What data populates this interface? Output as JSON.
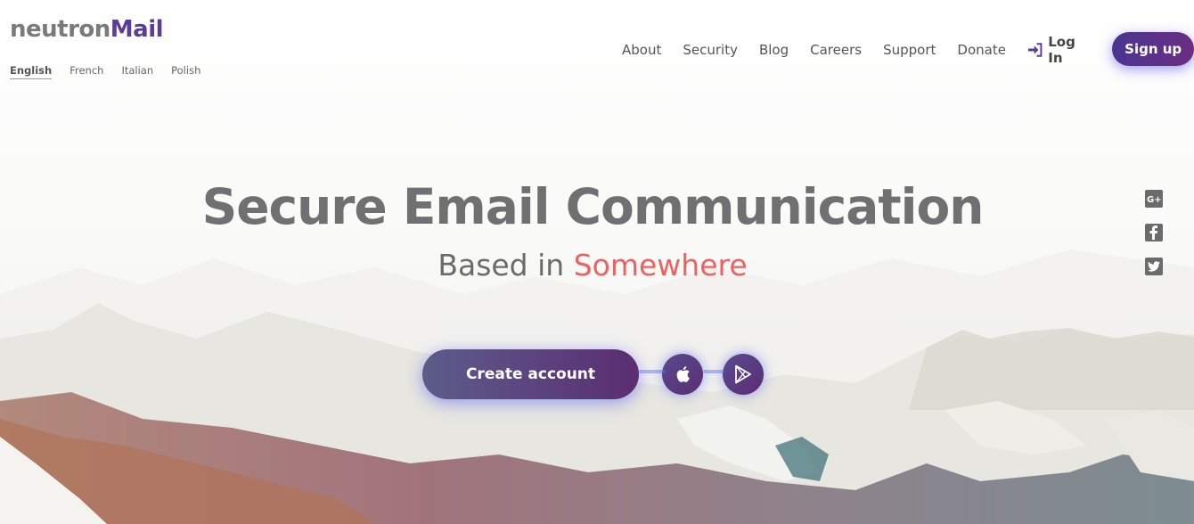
{
  "brand": {
    "neutron": "neutron",
    "mail": "Mail",
    "accent": "#5b3c96"
  },
  "languages": [
    {
      "label": "English",
      "active": true
    },
    {
      "label": "French",
      "active": false
    },
    {
      "label": "Italian",
      "active": false
    },
    {
      "label": "Polish",
      "active": false
    }
  ],
  "nav": {
    "links": [
      "About",
      "Security",
      "Blog",
      "Careers",
      "Support",
      "Donate"
    ],
    "login_label": "Log In",
    "login_icon": "sign-in-icon",
    "signup_label": "Sign up"
  },
  "hero": {
    "title": "Secure Email Communication",
    "subtitle_prefix": "Based in",
    "subtitle_place": "Somewhere",
    "place_color": "#ec6262"
  },
  "cta": {
    "create_label": "Create account",
    "apps": [
      "apple-icon",
      "google-play-icon"
    ]
  },
  "social": [
    "google-plus-icon",
    "facebook-icon",
    "twitter-icon"
  ]
}
